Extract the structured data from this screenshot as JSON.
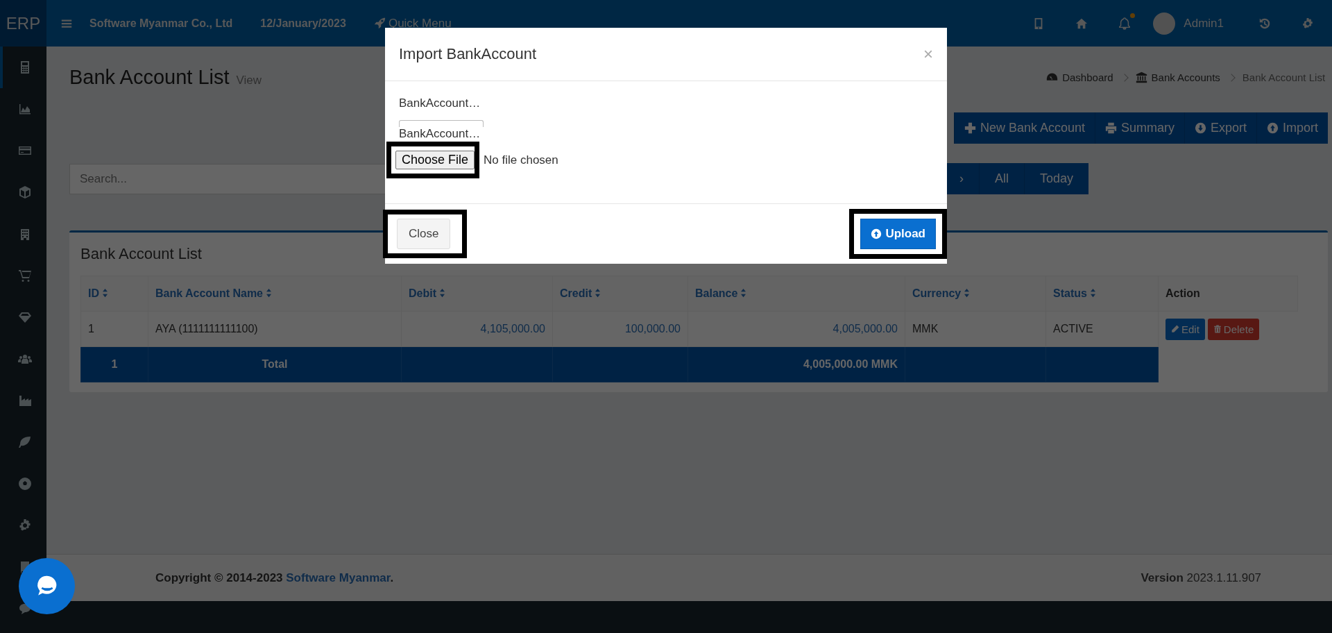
{
  "topbar": {
    "logo": "ERP",
    "company": "Software Myanmar Co., Ltd",
    "date": "12/January/2023",
    "quick_menu": "Quick Menu",
    "user": "Admin1"
  },
  "sidebar": {
    "items": [
      {
        "selected": true
      },
      {
        "selected": false
      },
      {
        "selected": false
      },
      {
        "selected": false
      },
      {
        "selected": false
      },
      {
        "selected": false
      },
      {
        "selected": false
      },
      {
        "selected": false
      },
      {
        "selected": false
      },
      {
        "selected": false
      },
      {
        "selected": false
      },
      {
        "selected": false
      },
      {
        "selected": false
      },
      {
        "selected": false
      }
    ]
  },
  "page": {
    "title": "Bank Account List",
    "subtitle": "View",
    "breadcrumb": [
      "Dashboard",
      "Bank Accounts",
      "Bank Account List"
    ]
  },
  "toolbar": [
    "New Bank Account",
    "Summary",
    "Export",
    "Import"
  ],
  "search": {
    "placeholder": "Search..."
  },
  "filters": [
    {
      "label": "›",
      "selected": false
    },
    {
      "label": "All",
      "selected": false
    },
    {
      "label": "Today",
      "selected": false
    }
  ],
  "card": {
    "title": "Bank Account List",
    "columns": [
      {
        "label": "ID",
        "sortable": true,
        "kind": "text"
      },
      {
        "label": "Bank Account Name",
        "sortable": true,
        "kind": "text"
      },
      {
        "label": "Debit",
        "sortable": true,
        "kind": "amount"
      },
      {
        "label": "Credit",
        "sortable": true,
        "kind": "amount"
      },
      {
        "label": "Balance",
        "sortable": true,
        "kind": "amount"
      },
      {
        "label": "Currency",
        "sortable": true,
        "kind": "text"
      },
      {
        "label": "Status",
        "sortable": true,
        "kind": "text"
      },
      {
        "label": "Action",
        "sortable": false,
        "kind": "action"
      }
    ],
    "rows": [
      {
        "cells": [
          "1",
          "AYA (1111111111100)",
          "4,105,000.00",
          "100,000.00",
          "4,005,000.00",
          "MMK",
          "ACTIVE"
        ],
        "actions": [
          "Edit",
          "Delete"
        ]
      }
    ],
    "total": {
      "id": "1",
      "label": "Total",
      "balance": "4,005,000.00 MMK"
    }
  },
  "modal": {
    "title": "Import BankAccount",
    "close_icon": "×",
    "labels": [
      "BankAccount…",
      "BankAccount…"
    ],
    "file_button": "Choose File",
    "file_status": "No file chosen",
    "close_button": "Close",
    "upload_button": "Upload"
  },
  "footer": {
    "copyright": "Copyright © 2014-2023",
    "link": "Software Myanmar",
    "period": ".",
    "version_label": "Version",
    "version": "2023.1.11.907"
  }
}
